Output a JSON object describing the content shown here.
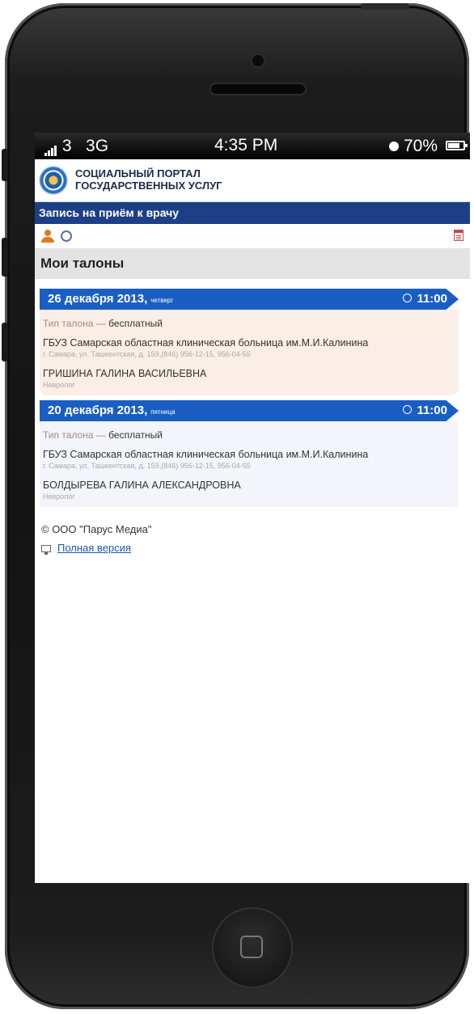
{
  "status_bar": {
    "carrier": "3",
    "network": "3G",
    "time": "4:35 PM",
    "battery": "70%"
  },
  "header": {
    "logo_line1": "СОЦИАЛЬНЫЙ ПОРТАЛ",
    "logo_line2": "ГОСУДАРСТВЕННЫХ УСЛУГ"
  },
  "nav": {
    "title": "Запись на приём к врачу"
  },
  "section": {
    "title": "Мои талоны"
  },
  "tickets": [
    {
      "date": "26 декабря 2013,",
      "weekday": "четверг",
      "time": "11:00",
      "type_label": "Тип талона —",
      "type_value": "бесплатный",
      "clinic": "ГБУЗ Самарская областная клиническая больница им.М.И.Калинина",
      "address": "г. Самара, ул. Ташкентская, д. 159,(846) 956-12-15, 956-04-55",
      "doctor": "ГРИШИНА ГАЛИНА ВАСИЛЬЕВНА",
      "specialty": "Невролог"
    },
    {
      "date": "20 декабря 2013,",
      "weekday": "пятница",
      "time": "11:00",
      "type_label": "Тип талона —",
      "type_value": "бесплатный",
      "clinic": "ГБУЗ Самарская областная клиническая больница им.М.И.Калинина",
      "address": "г. Самара, ул. Ташкентская, д. 159,(846) 956-12-15, 956-04-55",
      "doctor": "БОЛДЫРЕВА ГАЛИНА АЛЕКСАНДРОВНА",
      "specialty": "Невролог"
    }
  ],
  "footer": {
    "copyright": "© ООО \"Парус Медиа\"",
    "full_version": "Полная версия"
  },
  "colors": {
    "nav_bg": "#1d3f86",
    "ticket_bar": "#1a5ec4",
    "ticket1_bg": "#fbeee6",
    "link": "#1b54b5"
  }
}
